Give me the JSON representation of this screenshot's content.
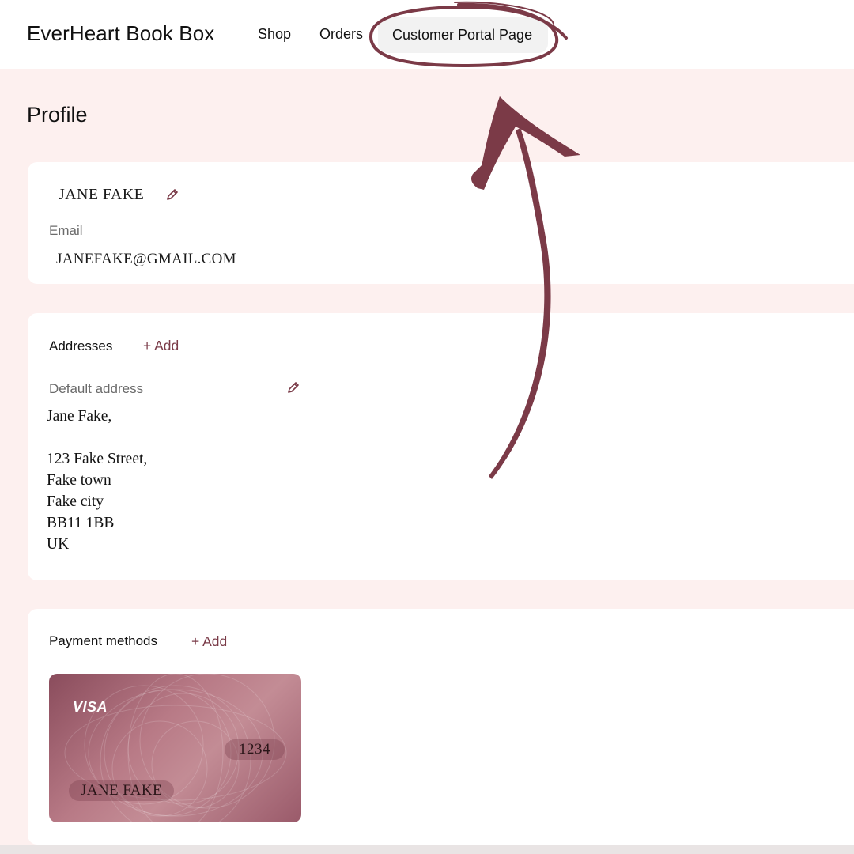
{
  "header": {
    "brand": "EverHeart Book Box",
    "nav": {
      "shop": "Shop",
      "orders": "Orders",
      "portal": "Customer Portal Page"
    }
  },
  "page": {
    "title": "Profile"
  },
  "profile": {
    "name": "JANE FAKE",
    "email_label": "Email",
    "email_value": "JANEFAKE@GMAIL.COM"
  },
  "addresses": {
    "title": "Addresses",
    "add_label": "+ Add",
    "default_label": "Default address",
    "lines": [
      "Jane Fake,",
      "123 Fake Street,",
      "Fake town",
      "Fake city",
      "BB11 1BB",
      "UK"
    ]
  },
  "payments": {
    "title": "Payment methods",
    "add_label": "+ Add",
    "card": {
      "brand": "VISA",
      "last4": "1234",
      "holder": "JANE FAKE"
    }
  },
  "colors": {
    "accent": "#7a3b48",
    "annotation": "#7b3a47",
    "page_background": "#fdf0ef"
  },
  "icons": {
    "edit": "pencil-icon"
  }
}
